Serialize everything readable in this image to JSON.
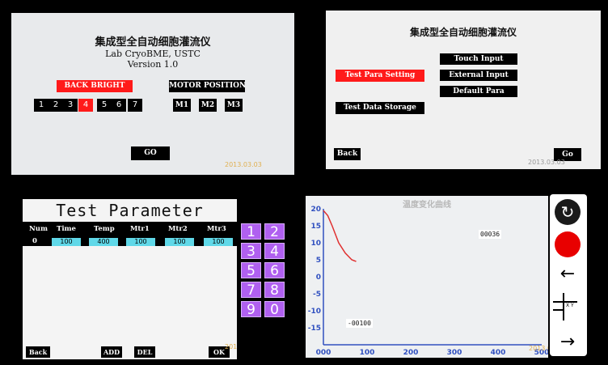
{
  "panel1": {
    "title": "集成型全自动细胞灌流仪",
    "lab": "Lab CryoBME, USTC",
    "version": "Version 1.0",
    "back_bright_label": "BACK  BRIGHT",
    "motor_position_label": "MOTOR POSITION",
    "brightness_levels": [
      "1",
      "2",
      "3",
      "4",
      "5",
      "6",
      "7"
    ],
    "brightness_selected": "4",
    "motors": [
      "M1",
      "M2",
      "M3"
    ],
    "go_label": "GO",
    "date": "2013.03.03"
  },
  "panel2": {
    "title": "集成型全自动细胞灌流仪",
    "test_para_label": "Test Para Setting",
    "touch_input_label": "Touch Input",
    "external_input_label": "External Input",
    "default_para_label": "Default Para",
    "test_data_storage_label": "Test Data Storage",
    "back_label": "Back",
    "go_label": "Go",
    "date": "2013.03.03"
  },
  "panel3": {
    "title": "Test Parameter",
    "headers": [
      "Num",
      "Time",
      "Temp",
      "Mtr1",
      "Mtr2",
      "Mtr3"
    ],
    "row": {
      "num": "0",
      "values": [
        "100",
        "400",
        "100",
        "100",
        "100"
      ]
    },
    "keypad": [
      "1",
      "2",
      "3",
      "4",
      "5",
      "6",
      "7",
      "8",
      "9",
      "0"
    ],
    "back_label": "Back",
    "add_label": "ADD",
    "del_label": "DEL",
    "ok_label": "OK",
    "date": "2013.03.03"
  },
  "panel4": {
    "title": "温度变化曲线",
    "time_readout": "00036",
    "value_readout": "-00100",
    "date": "2013.03.03",
    "y_ticks": [
      "20",
      "15",
      "10",
      "5",
      "0",
      "-5",
      "-10",
      "-15",
      "-20"
    ],
    "x_ticks": [
      "000",
      "100",
      "200",
      "300",
      "400",
      "500"
    ],
    "curve": [
      [
        0,
        19.5
      ],
      [
        10,
        18
      ],
      [
        20,
        15
      ],
      [
        35,
        10
      ],
      [
        50,
        7
      ],
      [
        65,
        5
      ],
      [
        75,
        4.5
      ]
    ],
    "axis_color": "#3050c0",
    "curve_color": "#e03030"
  },
  "side_controls": {
    "icons": [
      "refresh-icon",
      "record-icon",
      "back-arrow-icon",
      "axis-toggle-icon",
      "forward-arrow-icon"
    ],
    "axis_label": "X Y"
  },
  "colors": {
    "accent_red": "#ff1a1a",
    "keypad_purple": "#b060f0",
    "value_cyan": "#60d8e8"
  }
}
